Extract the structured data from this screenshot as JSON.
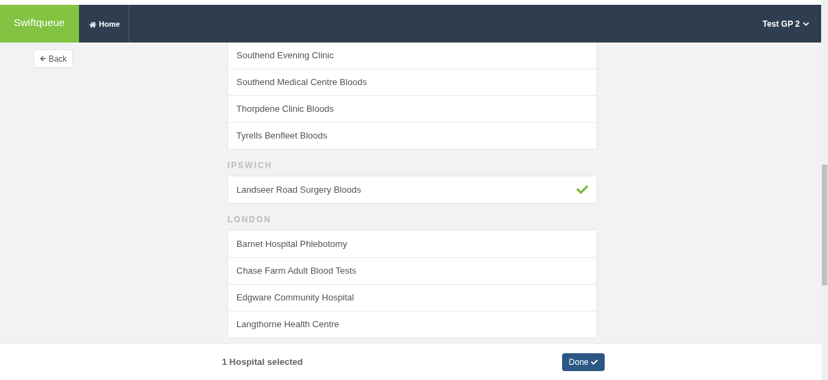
{
  "navbar": {
    "brand": "Swiftqueue",
    "home": "Home",
    "user": "Test GP 2"
  },
  "back": "Back",
  "groups": [
    {
      "items": [
        {
          "name": "Southend Evening Clinic",
          "selected": false
        },
        {
          "name": "Southend Medical Centre Bloods",
          "selected": false
        },
        {
          "name": "Thorpdene Clinic Bloods",
          "selected": false
        },
        {
          "name": "Tyrells Benfleet Bloods",
          "selected": false
        }
      ]
    },
    {
      "heading": "IPSWICH",
      "items": [
        {
          "name": "Landseer Road Surgery Bloods",
          "selected": true
        }
      ]
    },
    {
      "heading": "LONDON",
      "items": [
        {
          "name": "Barnet Hospital Phlebotomy",
          "selected": false
        },
        {
          "name": "Chase Farm Adult Blood Tests",
          "selected": false
        },
        {
          "name": "Edgware Community Hospital",
          "selected": false
        },
        {
          "name": "Langthorne Health Centre",
          "selected": false
        }
      ]
    }
  ],
  "footer": {
    "count": "1",
    "label": "Hospital selected",
    "done": "Done"
  }
}
